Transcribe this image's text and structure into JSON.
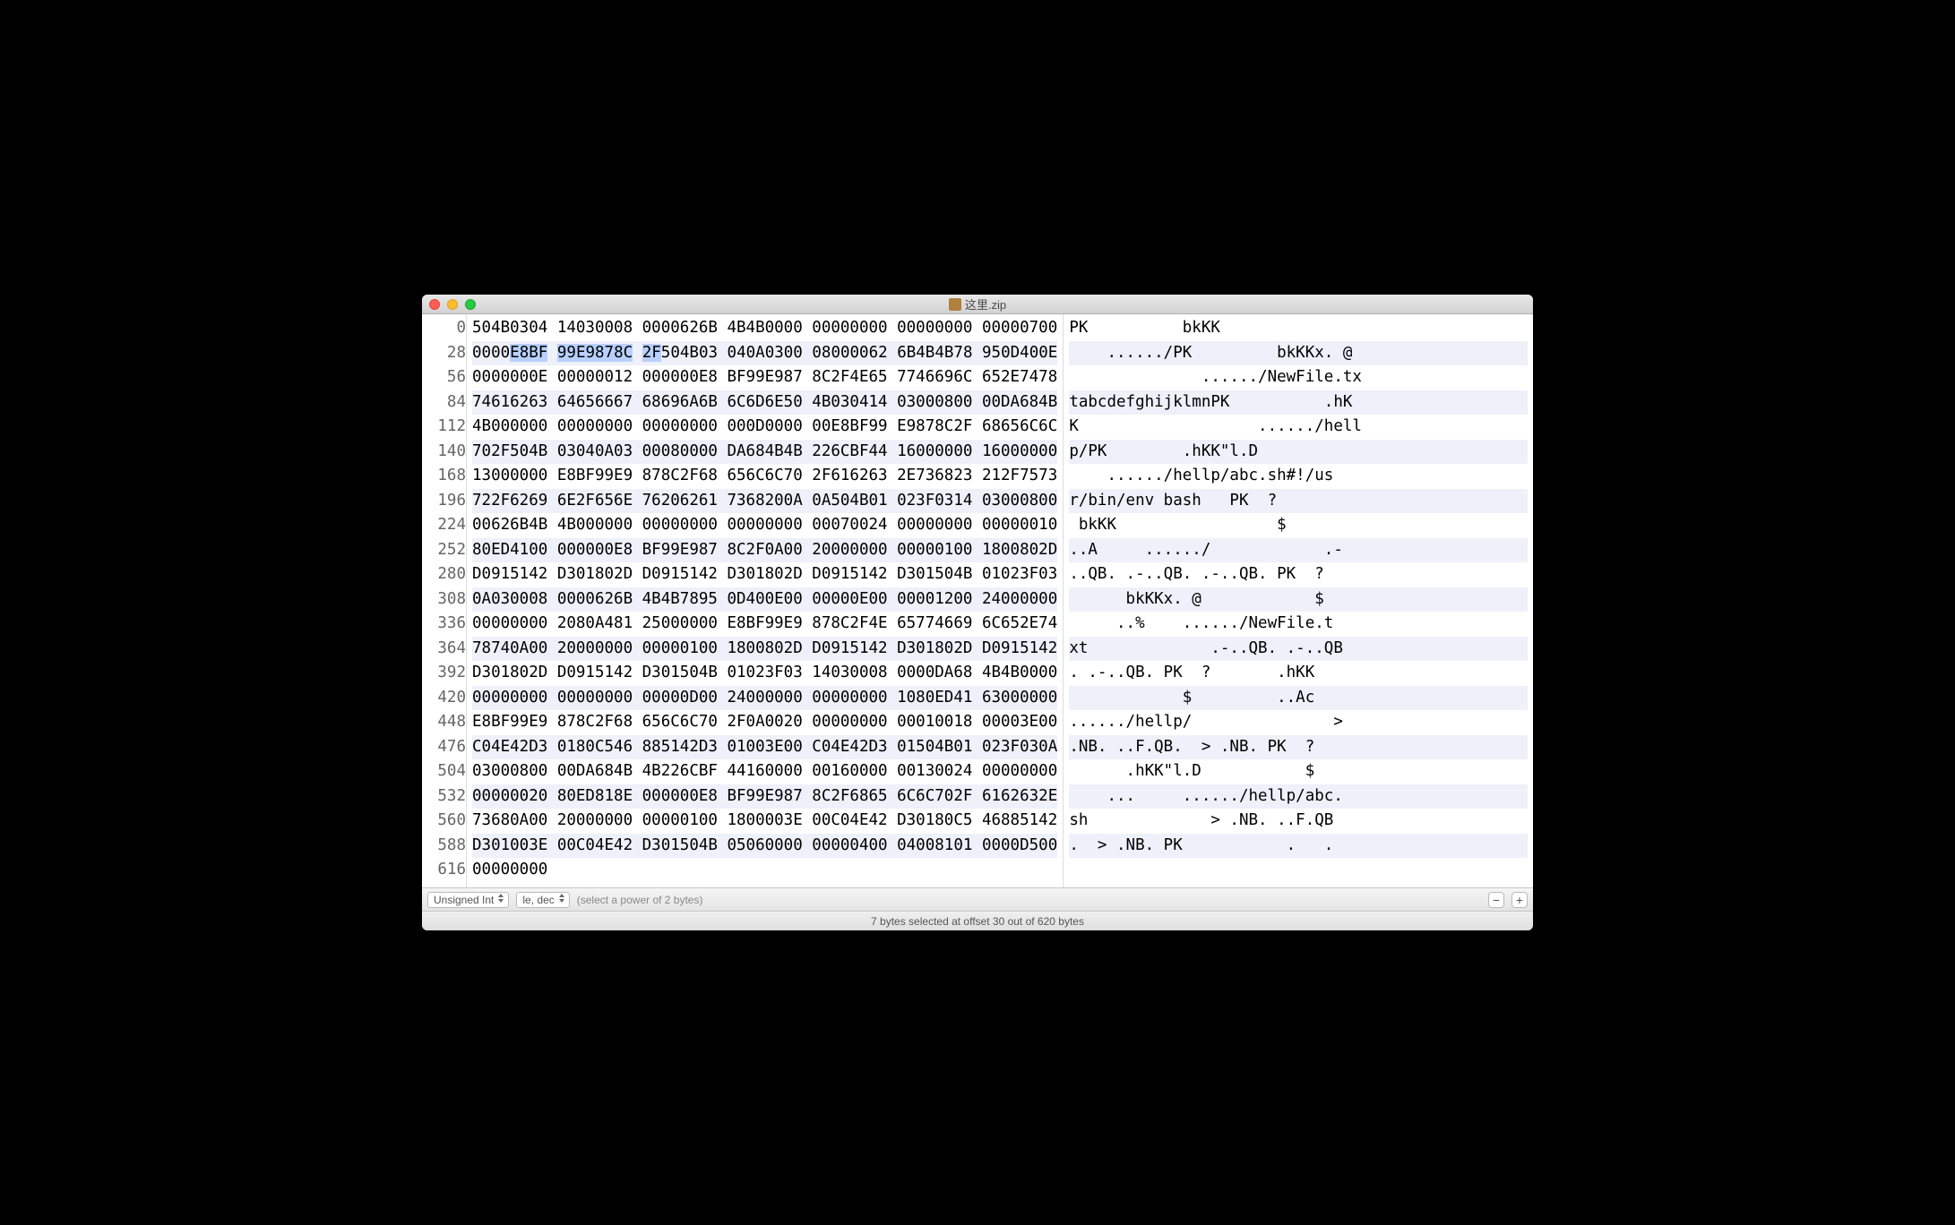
{
  "window": {
    "title": "这里.zip"
  },
  "toolbar": {
    "type_select": "Unsigned Int",
    "endian_select": "le, dec",
    "hint": "(select a power of 2 bytes)"
  },
  "status": "7 bytes selected at offset 30 out of 620 bytes",
  "selection": {
    "row": 1,
    "start": 2,
    "len": 7
  },
  "rows": [
    {
      "off": "0",
      "hex": [
        "504B0304",
        "14030008",
        "0000626B",
        "4B4B0000",
        "00000000",
        "00000000",
        "00000700"
      ],
      "asc": "PK          bkKK"
    },
    {
      "off": "28",
      "hex": [
        "0000E8BF",
        "99E9878C",
        "2F504B03",
        "040A0300",
        "08000062",
        "6B4B4B78",
        "950D400E"
      ],
      "asc": "    ....../PK         bkKKx. @"
    },
    {
      "off": "56",
      "hex": [
        "0000000E",
        "00000012",
        "000000E8",
        "BF99E987",
        "8C2F4E65",
        "7746696C",
        "652E7478"
      ],
      "asc": "              ....../NewFile.tx"
    },
    {
      "off": "84",
      "hex": [
        "74616263",
        "64656667",
        "68696A6B",
        "6C6D6E50",
        "4B030414",
        "03000800",
        "00DA684B"
      ],
      "asc": "tabcdefghijklmnPK          .hK"
    },
    {
      "off": "112",
      "hex": [
        "4B000000",
        "00000000",
        "00000000",
        "000D0000",
        "00E8BF99",
        "E9878C2F",
        "68656C6C"
      ],
      "asc": "K                   ....../hell"
    },
    {
      "off": "140",
      "hex": [
        "702F504B",
        "03040A03",
        "00080000",
        "DA684B4B",
        "226CBF44",
        "16000000",
        "16000000"
      ],
      "asc": "p/PK        .hKK\"l.D"
    },
    {
      "off": "168",
      "hex": [
        "13000000",
        "E8BF99E9",
        "878C2F68",
        "656C6C70",
        "2F616263",
        "2E736823",
        "212F7573"
      ],
      "asc": "    ....../hellp/abc.sh#!/us"
    },
    {
      "off": "196",
      "hex": [
        "722F6269",
        "6E2F656E",
        "76206261",
        "7368200A",
        "0A504B01",
        "023F0314",
        "03000800"
      ],
      "asc": "r/bin/env bash   PK  ?"
    },
    {
      "off": "224",
      "hex": [
        "00626B4B",
        "4B000000",
        "00000000",
        "00000000",
        "00070024",
        "00000000",
        "00000010"
      ],
      "asc": " bkKK                 $"
    },
    {
      "off": "252",
      "hex": [
        "80ED4100",
        "000000E8",
        "BF99E987",
        "8C2F0A00",
        "20000000",
        "00000100",
        "1800802D"
      ],
      "asc": "..A     ....../            .-"
    },
    {
      "off": "280",
      "hex": [
        "D0915142",
        "D301802D",
        "D0915142",
        "D301802D",
        "D0915142",
        "D301504B",
        "01023F03"
      ],
      "asc": "..QB. .-..QB. .-..QB. PK  ?"
    },
    {
      "off": "308",
      "hex": [
        "0A030008",
        "0000626B",
        "4B4B7895",
        "0D400E00",
        "00000E00",
        "00001200",
        "24000000"
      ],
      "asc": "      bkKKx. @            $"
    },
    {
      "off": "336",
      "hex": [
        "00000000",
        "2080A481",
        "25000000",
        "E8BF99E9",
        "878C2F4E",
        "65774669",
        "6C652E74"
      ],
      "asc": "     ..%    ....../NewFile.t"
    },
    {
      "off": "364",
      "hex": [
        "78740A00",
        "20000000",
        "00000100",
        "1800802D",
        "D0915142",
        "D301802D",
        "D0915142"
      ],
      "asc": "xt             .-..QB. .-..QB"
    },
    {
      "off": "392",
      "hex": [
        "D301802D",
        "D0915142",
        "D301504B",
        "01023F03",
        "14030008",
        "0000DA68",
        "4B4B0000"
      ],
      "asc": ". .-..QB. PK  ?       .hKK"
    },
    {
      "off": "420",
      "hex": [
        "00000000",
        "00000000",
        "00000D00",
        "24000000",
        "00000000",
        "1080ED41",
        "63000000"
      ],
      "asc": "            $         ..Ac"
    },
    {
      "off": "448",
      "hex": [
        "E8BF99E9",
        "878C2F68",
        "656C6C70",
        "2F0A0020",
        "00000000",
        "00010018",
        "00003E00"
      ],
      "asc": "....../hellp/               >"
    },
    {
      "off": "476",
      "hex": [
        "C04E42D3",
        "0180C546",
        "885142D3",
        "01003E00",
        "C04E42D3",
        "01504B01",
        "023F030A"
      ],
      "asc": ".NB. ..F.QB.  > .NB. PK  ?"
    },
    {
      "off": "504",
      "hex": [
        "03000800",
        "00DA684B",
        "4B226CBF",
        "44160000",
        "00160000",
        "00130024",
        "00000000"
      ],
      "asc": "      .hKK\"l.D           $"
    },
    {
      "off": "532",
      "hex": [
        "00000020",
        "80ED818E",
        "000000E8",
        "BF99E987",
        "8C2F6865",
        "6C6C702F",
        "6162632E"
      ],
      "asc": "    ...     ....../hellp/abc."
    },
    {
      "off": "560",
      "hex": [
        "73680A00",
        "20000000",
        "00000100",
        "1800003E",
        "00C04E42",
        "D30180C5",
        "46885142"
      ],
      "asc": "sh             > .NB. ..F.QB"
    },
    {
      "off": "588",
      "hex": [
        "D301003E",
        "00C04E42",
        "D301504B",
        "05060000",
        "00000400",
        "04008101",
        "0000D500"
      ],
      "asc": ".  > .NB. PK           .   ."
    },
    {
      "off": "616",
      "hex": [
        "00000000",
        "",
        "",
        "",
        "",
        "",
        ""
      ],
      "asc": ""
    }
  ]
}
